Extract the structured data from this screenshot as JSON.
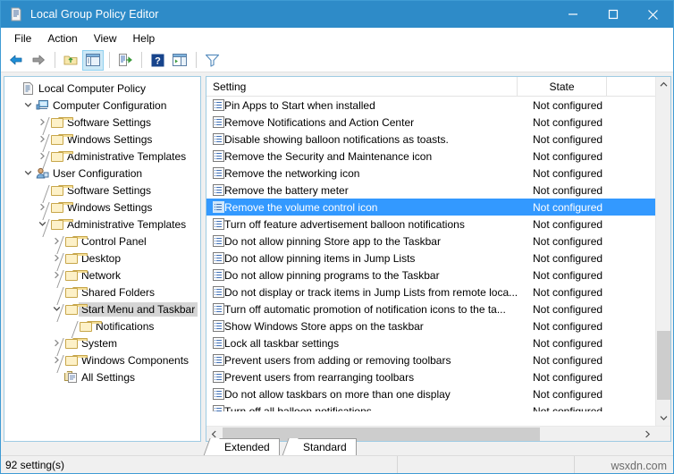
{
  "window": {
    "title": "Local Group Policy Editor",
    "icon": "policy-document-icon",
    "minimize_label": "Minimize",
    "maximize_label": "Maximize",
    "close_label": "Close",
    "titlebar_color": "#2e8bc8"
  },
  "menubar": {
    "items": [
      {
        "label": "File"
      },
      {
        "label": "Action"
      },
      {
        "label": "View"
      },
      {
        "label": "Help"
      }
    ]
  },
  "toolbar": {
    "buttons": [
      {
        "name": "back-button",
        "icon": "back-arrow-icon"
      },
      {
        "name": "forward-button",
        "icon": "forward-arrow-icon"
      },
      {
        "name": "up-one-level-button",
        "icon": "up-folder-icon"
      },
      {
        "name": "show-hide-console-tree-button",
        "icon": "console-tree-icon",
        "pressed": true
      },
      {
        "name": "export-list-button",
        "icon": "export-list-icon"
      },
      {
        "name": "help-button",
        "icon": "help-question-icon"
      },
      {
        "name": "show-action-pane-button",
        "icon": "action-pane-icon"
      },
      {
        "name": "filter-button",
        "icon": "filter-funnel-icon"
      }
    ]
  },
  "tree": {
    "items": [
      {
        "label": "Local Computer Policy",
        "indent": 0,
        "twisty": "none",
        "icon": "policy-document-icon",
        "selected": false
      },
      {
        "label": "Computer Configuration",
        "indent": 1,
        "twisty": "expanded",
        "icon": "computer-icon",
        "selected": false
      },
      {
        "label": "Software Settings",
        "indent": 2,
        "twisty": "collapsed",
        "icon": "folder-icon",
        "selected": false
      },
      {
        "label": "Windows Settings",
        "indent": 2,
        "twisty": "collapsed",
        "icon": "folder-icon",
        "selected": false
      },
      {
        "label": "Administrative Templates",
        "indent": 2,
        "twisty": "collapsed",
        "icon": "folder-icon",
        "selected": false
      },
      {
        "label": "User Configuration",
        "indent": 1,
        "twisty": "expanded",
        "icon": "user-icon",
        "selected": false
      },
      {
        "label": "Software Settings",
        "indent": 2,
        "twisty": "none",
        "icon": "folder-icon",
        "selected": false
      },
      {
        "label": "Windows Settings",
        "indent": 2,
        "twisty": "collapsed",
        "icon": "folder-icon",
        "selected": false
      },
      {
        "label": "Administrative Templates",
        "indent": 2,
        "twisty": "expanded",
        "icon": "folder-icon",
        "selected": false
      },
      {
        "label": "Control Panel",
        "indent": 3,
        "twisty": "collapsed",
        "icon": "folder-icon",
        "selected": false
      },
      {
        "label": "Desktop",
        "indent": 3,
        "twisty": "collapsed",
        "icon": "folder-icon",
        "selected": false
      },
      {
        "label": "Network",
        "indent": 3,
        "twisty": "collapsed",
        "icon": "folder-icon",
        "selected": false
      },
      {
        "label": "Shared Folders",
        "indent": 3,
        "twisty": "none",
        "icon": "folder-icon",
        "selected": false
      },
      {
        "label": "Start Menu and Taskbar",
        "indent": 3,
        "twisty": "expanded",
        "icon": "folder-icon",
        "selected": true
      },
      {
        "label": "Notifications",
        "indent": 4,
        "twisty": "none",
        "icon": "folder-icon",
        "selected": false
      },
      {
        "label": "System",
        "indent": 3,
        "twisty": "collapsed",
        "icon": "folder-icon",
        "selected": false
      },
      {
        "label": "Windows Components",
        "indent": 3,
        "twisty": "collapsed",
        "icon": "folder-icon",
        "selected": false
      },
      {
        "label": "All Settings",
        "indent": 3,
        "twisty": "none",
        "icon": "all-settings-icon",
        "selected": false
      }
    ]
  },
  "list": {
    "columns": [
      {
        "label": "Setting"
      },
      {
        "label": "State"
      }
    ],
    "selected_row_color": "#3399ff",
    "rows": [
      {
        "setting": "Pin Apps to Start when installed",
        "state": "Not configured",
        "selected": false
      },
      {
        "setting": "Remove Notifications and Action Center",
        "state": "Not configured",
        "selected": false
      },
      {
        "setting": "Disable showing balloon notifications as toasts.",
        "state": "Not configured",
        "selected": false
      },
      {
        "setting": "Remove the Security and Maintenance icon",
        "state": "Not configured",
        "selected": false
      },
      {
        "setting": "Remove the networking icon",
        "state": "Not configured",
        "selected": false
      },
      {
        "setting": "Remove the battery meter",
        "state": "Not configured",
        "selected": false
      },
      {
        "setting": "Remove the volume control icon",
        "state": "Not configured",
        "selected": true
      },
      {
        "setting": "Turn off feature advertisement balloon notifications",
        "state": "Not configured",
        "selected": false
      },
      {
        "setting": "Do not allow pinning Store app to the Taskbar",
        "state": "Not configured",
        "selected": false
      },
      {
        "setting": "Do not allow pinning items in Jump Lists",
        "state": "Not configured",
        "selected": false
      },
      {
        "setting": "Do not allow pinning programs to the Taskbar",
        "state": "Not configured",
        "selected": false
      },
      {
        "setting": "Do not display or track items in Jump Lists from remote loca...",
        "state": "Not configured",
        "selected": false
      },
      {
        "setting": "Turn off automatic promotion of notification icons to the ta...",
        "state": "Not configured",
        "selected": false
      },
      {
        "setting": "Show Windows Store apps on the taskbar",
        "state": "Not configured",
        "selected": false
      },
      {
        "setting": "Lock all taskbar settings",
        "state": "Not configured",
        "selected": false
      },
      {
        "setting": "Prevent users from adding or removing toolbars",
        "state": "Not configured",
        "selected": false
      },
      {
        "setting": "Prevent users from rearranging toolbars",
        "state": "Not configured",
        "selected": false
      },
      {
        "setting": "Do not allow taskbars on more than one display",
        "state": "Not configured",
        "selected": false
      },
      {
        "setting": "Turn off all balloon notifications",
        "state": "Not configured",
        "selected": false
      }
    ]
  },
  "tabs": [
    {
      "label": "Extended",
      "active": false
    },
    {
      "label": "Standard",
      "active": true
    }
  ],
  "statusbar": {
    "text": "92 setting(s)"
  },
  "watermark": {
    "text": "wsxdn.com"
  }
}
